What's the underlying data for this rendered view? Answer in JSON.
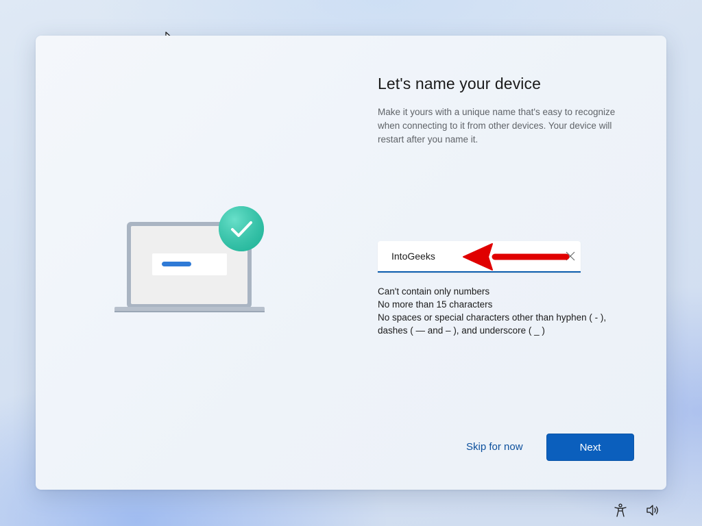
{
  "page": {
    "title": "Let's name your device",
    "description": "Make it yours with a unique name that's easy to recognize when connecting to it from other devices. Your device will restart after you name it."
  },
  "name_field": {
    "value": "IntoGeeks",
    "clear_icon": "close-icon"
  },
  "rules": [
    "Can't contain only numbers",
    "No more than 15 characters",
    "No spaces or special characters other than hyphen ( - ),",
    "dashes ( — and – ), and underscore ( _ )"
  ],
  "actions": {
    "skip_label": "Skip for now",
    "next_label": "Next"
  },
  "system_tray": {
    "accessibility_icon": "accessibility-icon",
    "volume_icon": "volume-icon"
  },
  "colors": {
    "accent": "#0b5fbd",
    "link": "#0b4f9c",
    "check_badge": "#2ec4a8",
    "annotation_arrow": "#e00000"
  }
}
